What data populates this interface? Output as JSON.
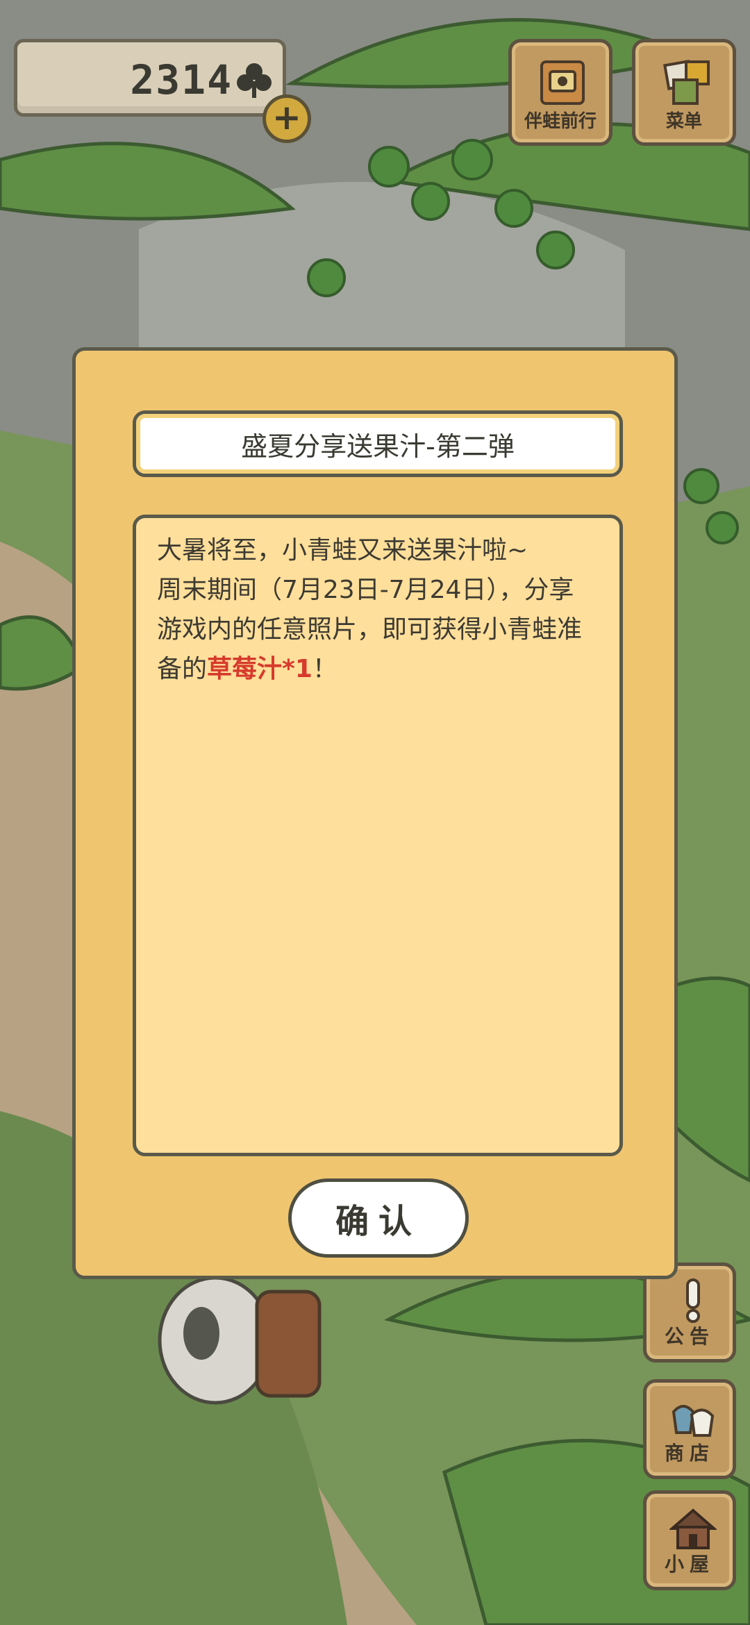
{
  "hud": {
    "clover_count": "2314",
    "clover_icon": "clover-icon",
    "add_icon": "plus-icon",
    "add_label": "+"
  },
  "top_buttons": {
    "travel_label": "伴蛙前行",
    "menu_label": "菜单"
  },
  "side_buttons": {
    "notice_label": "公告",
    "shop_label": "商店",
    "house_label": "小屋"
  },
  "dialog": {
    "title": "盛夏分享送果汁-第二弹",
    "body_line1": "大暑将至，小青蛙又来送果汁啦~",
    "body_line2": "周末期间（7月23日-7月24日），分享游戏内的任意照片，即可获得小青蛙准备的",
    "highlight": "草莓汁*1",
    "body_end": "！",
    "confirm_label": "确认"
  },
  "colors": {
    "dialog_bg": "#efc56f",
    "body_bg": "#ffdf9b",
    "highlight": "#d63a2c",
    "button_wood": "#c19a61"
  }
}
